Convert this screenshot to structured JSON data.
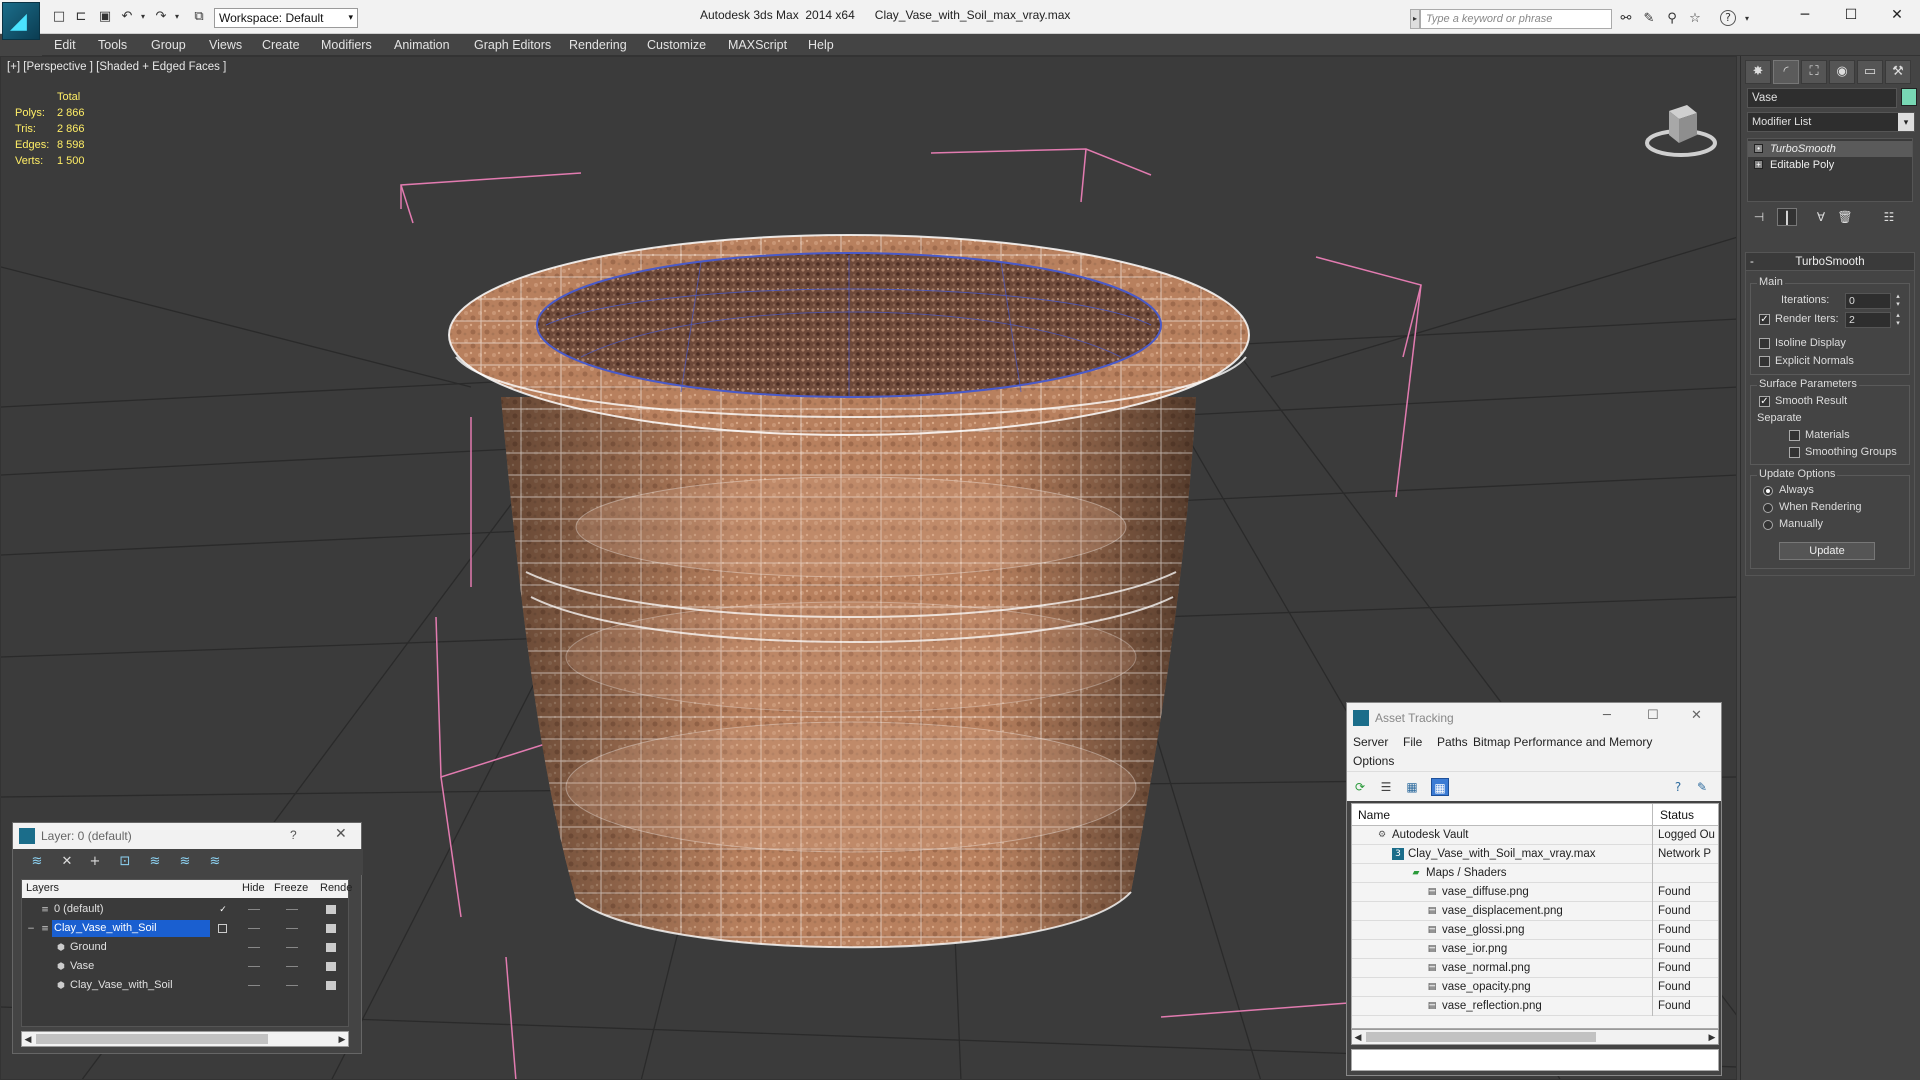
{
  "app": {
    "title": "Autodesk 3ds Max  2014 x64",
    "file": "Clay_Vase_with_Soil_max_vray.max",
    "workspace": "Workspace: Default",
    "search_placeholder": "Type a keyword or phrase"
  },
  "menu": [
    "Edit",
    "Tools",
    "Group",
    "Views",
    "Create",
    "Modifiers",
    "Animation",
    "Graph Editors",
    "Rendering",
    "Customize",
    "MAXScript",
    "Help"
  ],
  "viewport": {
    "label": "[+] [Perspective ] [Shaded + Edged Faces ]",
    "stats": {
      "header": "Total",
      "rows": [
        {
          "key": "Polys:",
          "value": "2 866"
        },
        {
          "key": "Tris:",
          "value": "2 866"
        },
        {
          "key": "Edges:",
          "value": "8 598"
        },
        {
          "key": "Verts:",
          "value": "1 500"
        }
      ]
    }
  },
  "command_panel": {
    "object_name": "Vase",
    "object_color": "#78d8b4",
    "modifier_list": "Modifier List",
    "stack": [
      "TurboSmooth",
      "Editable Poly"
    ],
    "rollout_title": "TurboSmooth",
    "main_group": "Main",
    "iterations_label": "Iterations:",
    "iterations_value": "0",
    "render_iters_label": "Render Iters:",
    "render_iters_value": "2",
    "isoline_label": "Isoline Display",
    "explicit_normals_label": "Explicit Normals",
    "surface_group": "Surface Parameters",
    "smooth_result_label": "Smooth Result",
    "separate_label": "Separate",
    "materials_label": "Materials",
    "smoothing_groups_label": "Smoothing Groups",
    "update_group": "Update Options",
    "always_label": "Always",
    "when_rendering_label": "When Rendering",
    "manually_label": "Manually",
    "update_button": "Update"
  },
  "layer_panel": {
    "title": "Layer: 0 (default)",
    "help": "?",
    "columns": {
      "layers": "Layers",
      "hide": "Hide",
      "freeze": "Freeze",
      "render": "Rende"
    },
    "rows": [
      {
        "name": "0 (default)",
        "indent": 0
      },
      {
        "name": "Clay_Vase_with_Soil",
        "indent": 0,
        "selected": true
      },
      {
        "name": "Ground",
        "indent": 1
      },
      {
        "name": "Vase",
        "indent": 1
      },
      {
        "name": "Clay_Vase_with_Soil",
        "indent": 1
      }
    ]
  },
  "asset_panel": {
    "title": "Asset Tracking",
    "menu": [
      "Server",
      "File",
      "Paths",
      "Bitmap Performance and Memory",
      "Options"
    ],
    "columns": {
      "name": "Name",
      "status": "Status"
    },
    "rows": [
      {
        "name": "Autodesk Vault",
        "status": "Logged Ou",
        "indent": 1,
        "icon": "vault"
      },
      {
        "name": "Clay_Vase_with_Soil_max_vray.max",
        "status": "Network P",
        "indent": 2,
        "icon": "max"
      },
      {
        "name": "Maps / Shaders",
        "status": "",
        "indent": 3,
        "icon": "folder"
      },
      {
        "name": "vase_diffuse.png",
        "status": "Found",
        "indent": 4,
        "icon": "image"
      },
      {
        "name": "vase_displacement.png",
        "status": "Found",
        "indent": 4,
        "icon": "image"
      },
      {
        "name": "vase_glossi.png",
        "status": "Found",
        "indent": 4,
        "icon": "image"
      },
      {
        "name": "vase_ior.png",
        "status": "Found",
        "indent": 4,
        "icon": "image"
      },
      {
        "name": "vase_normal.png",
        "status": "Found",
        "indent": 4,
        "icon": "image"
      },
      {
        "name": "vase_opacity.png",
        "status": "Found",
        "indent": 4,
        "icon": "image"
      },
      {
        "name": "vase_reflection.png",
        "status": "Found",
        "indent": 4,
        "icon": "image"
      }
    ]
  }
}
